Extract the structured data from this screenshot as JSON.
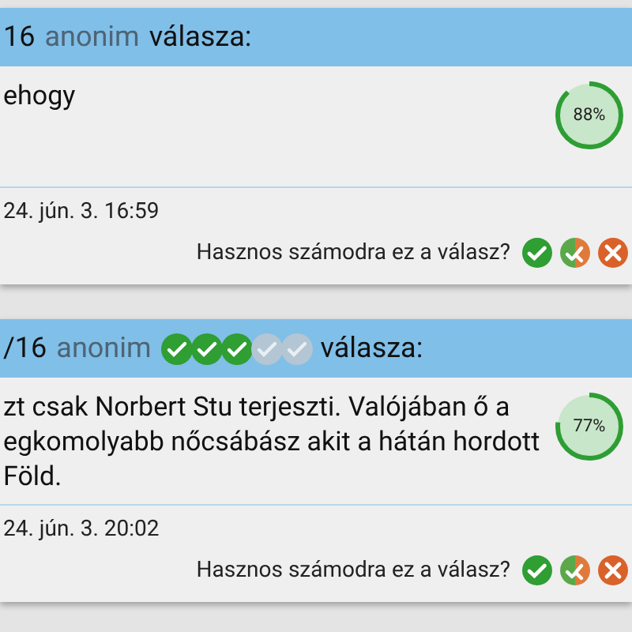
{
  "answers": [
    {
      "number": "16",
      "author": "anonim",
      "suffix": "válasza:",
      "lines": [
        "ehogy"
      ],
      "score": {
        "label": "88%"
      },
      "date": "24. jún. 3. 16:59",
      "question": "Hasznos számodra ez a válasz?"
    },
    {
      "number": "/16",
      "author": "anonim",
      "rating": [
        {
          "on": true
        },
        {
          "on": true
        },
        {
          "on": true
        },
        {
          "on": false
        },
        {
          "on": false
        }
      ],
      "suffix": "válasza:",
      "lines": [
        "zt csak Norbert Stu terjeszti. Valójában ő a",
        "egkomolyabb nőcsábász akit a hátán hordott",
        "Föld."
      ],
      "score": {
        "label": "77%"
      },
      "date": "24. jún. 3. 20:02",
      "question": "Hasznos számodra ez a válasz?"
    }
  ]
}
